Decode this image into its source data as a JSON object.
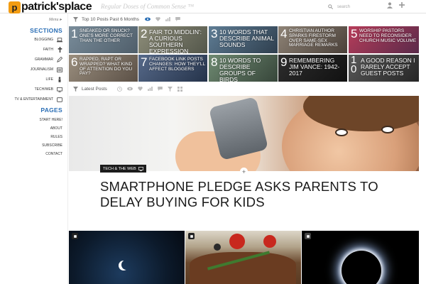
{
  "header": {
    "logo_badge": "p",
    "logo_text": "patrick'splace",
    "tagline": "Regular Doses of Common Sense ™",
    "search_placeholder": "search",
    "icons": [
      "user-icon",
      "plus-icon"
    ]
  },
  "sidebar": {
    "menu_toggle": "Menu ▸",
    "sections_title": "SECTIONS",
    "sections": [
      {
        "label": "BLOGGING",
        "icon": "laptop-icon"
      },
      {
        "label": "FAITH",
        "icon": "cross-icon"
      },
      {
        "label": "GRAMMAR",
        "icon": "pencil-icon"
      },
      {
        "label": "JOURNALISM",
        "icon": "newspaper-icon"
      },
      {
        "label": "LIFE",
        "icon": "person-icon"
      },
      {
        "label": "TECH/WEB",
        "icon": "monitor-icon"
      },
      {
        "label": "TV & ENTERTAINMENT",
        "icon": "tv-icon"
      }
    ],
    "pages_title": "PAGES",
    "pages": [
      "START HERE!",
      "ABOUT",
      "RULES",
      "SUBSCRIBE",
      "CONTACT"
    ]
  },
  "top_posts": {
    "label": "Top 10 Posts Past 6 Months",
    "items": [
      {
        "num": "1",
        "title": "SNEAKED OR SNUCK? ONE'S MORE CORRECT THAN THE OTHER"
      },
      {
        "num": "2",
        "title": "FAIR TO MIDDLIN': A CURIOUS SOUTHERN EXPRESSION"
      },
      {
        "num": "3",
        "title": "10 WORDS THAT DESCRIBE ANIMAL SOUNDS"
      },
      {
        "num": "4",
        "title": "CHRISTIAN AUTHOR SPARKS FIRESTORM OVER SAME-SEX MARRIAGE REMARKS"
      },
      {
        "num": "5",
        "title": "WORSHIP PASTORS NEED TO RECONSIDER CHURCH MUSIC VOLUME"
      },
      {
        "num": "6",
        "title": "RAPPED, RAPT OR WRAPPED? WHAT KIND OF ATTENTION DO YOU PAY?"
      },
      {
        "num": "7",
        "title": "FACEBOOK LINK POSTS CHANGES: HOW THEY'LL AFFECT BLOGGERS"
      },
      {
        "num": "8",
        "title": "10 WORDS TO DESCRIBE GROUPS OF BIRDS"
      },
      {
        "num": "9",
        "title": "REMEMBERING JIM VANCE: 1942-2017"
      },
      {
        "num": "10",
        "title": "A GOOD REASON I RARELY ACCEPT GUEST POSTS"
      }
    ]
  },
  "latest": {
    "label": "Latest Posts"
  },
  "hero": {
    "category": "TECH & THE WEB",
    "headline": "SMARTPHONE PLEDGE ASKS PARENTS TO DELAY BUYING FOR KIDS"
  }
}
